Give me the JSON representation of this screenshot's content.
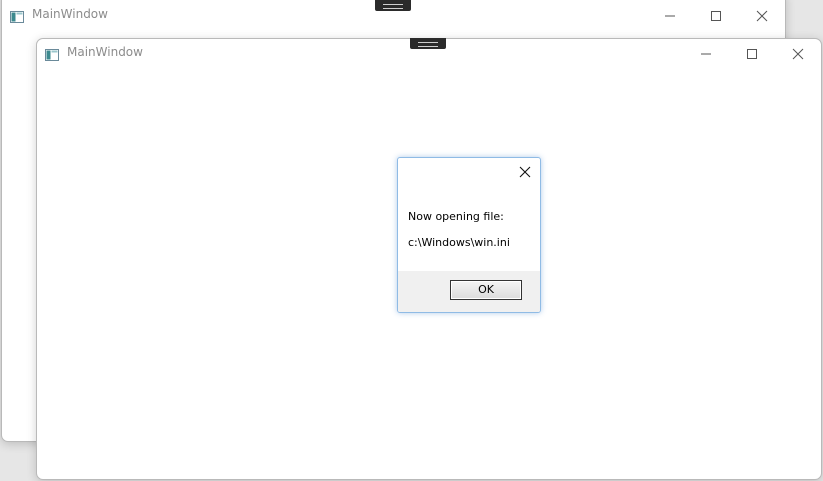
{
  "windows": {
    "back": {
      "title": "MainWindow"
    },
    "front": {
      "title": "MainWindow"
    }
  },
  "icons": {
    "app": "app-window-icon",
    "minimize": "minimize-icon",
    "maximize": "maximize-icon",
    "close": "close-icon"
  },
  "dialog": {
    "line1": "Now opening file:",
    "line2": "c:\\Windows\\win.ini",
    "ok_label": "OK"
  },
  "colors": {
    "title_text": "#8c8c8c",
    "dialog_border": "#8fbbe5",
    "footer_bg": "#f0f0f0"
  }
}
